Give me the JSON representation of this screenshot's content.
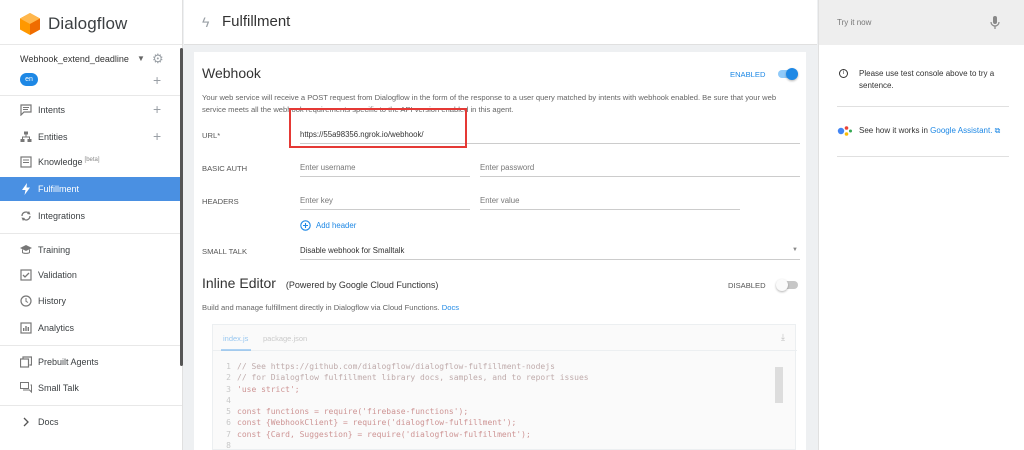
{
  "app": {
    "name": "Dialogflow"
  },
  "sidebar": {
    "agent_name": "Webhook_extend_deadline",
    "language": "en",
    "items": [
      {
        "label": "Intents",
        "icon": "intents-icon",
        "plus": "+"
      },
      {
        "label": "Entities",
        "icon": "entities-icon",
        "plus": "+"
      },
      {
        "label": "Knowledge",
        "beta": "[beta]",
        "icon": "knowledge-icon"
      },
      {
        "label": "Fulfillment",
        "icon": "fulfillment-icon",
        "active": true
      },
      {
        "label": "Integrations",
        "icon": "integrations-icon"
      },
      {
        "label": "Training",
        "icon": "training-icon"
      },
      {
        "label": "Validation",
        "icon": "validation-icon"
      },
      {
        "label": "History",
        "icon": "history-icon"
      },
      {
        "label": "Analytics",
        "icon": "analytics-icon"
      },
      {
        "label": "Prebuilt Agents",
        "icon": "prebuilt-agents-icon"
      },
      {
        "label": "Small Talk",
        "icon": "small-talk-icon"
      },
      {
        "label": "Docs",
        "icon": "chevron-right-icon"
      }
    ]
  },
  "header": {
    "title": "Fulfillment"
  },
  "webhook": {
    "title": "Webhook",
    "status_label": "ENABLED",
    "enabled": true,
    "description_line1": "Your web service will receive a POST request from Dialogflow in the form of the response to a user query matched by intents with webhook enabled. Be sure that your web",
    "description_line2": "service meets all the webhook requirements specific to the API version enabled in this agent.",
    "url_label": "URL*",
    "url_value": "https://55a98356.ngrok.io/webhook/",
    "basic_auth_label": "BASIC AUTH",
    "username_placeholder": "Enter username",
    "password_placeholder": "Enter password",
    "headers_label": "HEADERS",
    "key_placeholder": "Enter key",
    "value_placeholder": "Enter value",
    "add_header_label": "Add header",
    "small_talk_label": "SMALL TALK",
    "small_talk_value": "Disable webhook for Smalltalk"
  },
  "inline_editor": {
    "title": "Inline Editor",
    "subtitle": "(Powered by Google Cloud Functions)",
    "status_label": "DISABLED",
    "enabled": false,
    "description": "Build and manage fulfillment directly in Dialogflow via Cloud Functions.",
    "docs_link": "Docs",
    "tabs": [
      "index.js",
      "package.json"
    ],
    "code": [
      {
        "n": "1",
        "text": "// See https://github.com/dialogflow/dialogflow-fulfillment-nodejs",
        "comment": true
      },
      {
        "n": "2",
        "text": "// for Dialogflow fulfillment library docs, samples, and to report issues",
        "comment": true
      },
      {
        "n": "3",
        "text": "'use strict';"
      },
      {
        "n": "4",
        "text": ""
      },
      {
        "n": "5",
        "text": "const functions = require('firebase-functions');"
      },
      {
        "n": "6",
        "text": "const {WebhookClient} = require('dialogflow-fulfillment');"
      },
      {
        "n": "7",
        "text": "const {Card, Suggestion} = require('dialogflow-fulfillment');"
      },
      {
        "n": "8",
        "text": ""
      }
    ]
  },
  "try_panel": {
    "label": "Try it now",
    "info": "Please use test console above to try a sentence.",
    "ga_text": "See how it works in",
    "ga_link": "Google Assistant."
  },
  "colors": {
    "accent": "#4a90e2",
    "link": "#1e88e5",
    "highlight": "#e53935"
  }
}
